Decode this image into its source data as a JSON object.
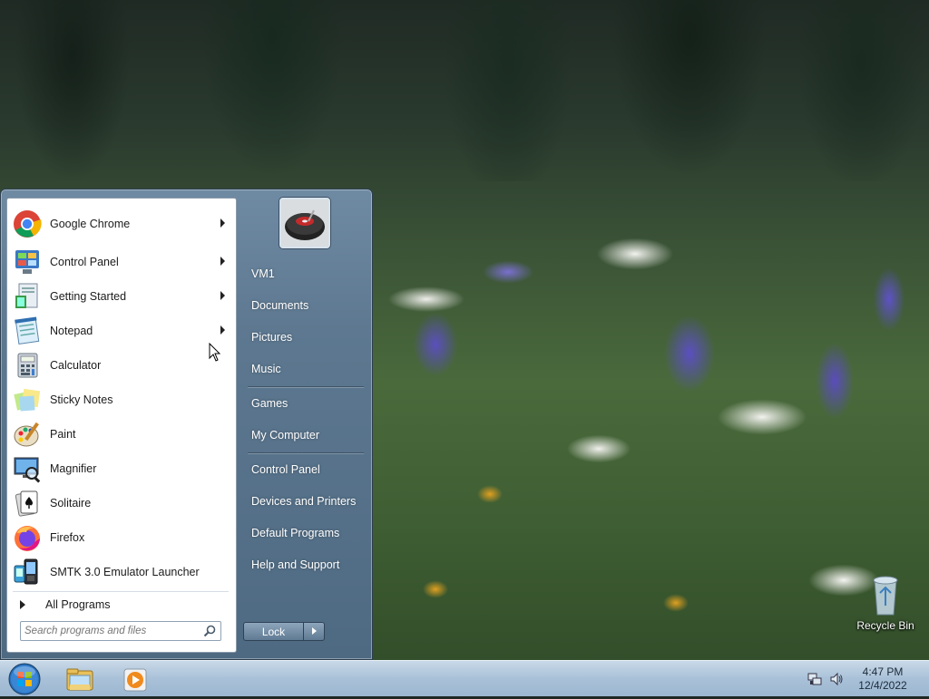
{
  "start_menu": {
    "pinned_programs": [
      {
        "label": "Google Chrome",
        "icon": "chrome-icon",
        "has_submenu": true
      },
      {
        "label": "Control Panel",
        "icon": "control-panel-icon",
        "has_submenu": true
      },
      {
        "label": "Getting Started",
        "icon": "getting-started-icon",
        "has_submenu": true
      },
      {
        "label": "Notepad",
        "icon": "notepad-icon",
        "has_submenu": true
      },
      {
        "label": "Calculator",
        "icon": "calculator-icon",
        "has_submenu": false
      },
      {
        "label": "Sticky Notes",
        "icon": "sticky-notes-icon",
        "has_submenu": false
      },
      {
        "label": "Paint",
        "icon": "paint-icon",
        "has_submenu": false
      },
      {
        "label": "Magnifier",
        "icon": "magnifier-icon",
        "has_submenu": false
      },
      {
        "label": "Solitaire",
        "icon": "solitaire-icon",
        "has_submenu": false
      },
      {
        "label": "Firefox",
        "icon": "firefox-icon",
        "has_submenu": false
      },
      {
        "label": "SMTK 3.0 Emulator Launcher",
        "icon": "smtk-icon",
        "has_submenu": false
      }
    ],
    "all_programs_label": "All Programs",
    "search": {
      "placeholder": "Search programs and files",
      "value": ""
    },
    "user_picture_icon": "user-avatar-icon",
    "right_items": [
      {
        "label": "VM1",
        "name": "user-folder-link"
      },
      {
        "label": "Documents",
        "name": "documents-link"
      },
      {
        "label": "Pictures",
        "name": "pictures-link"
      },
      {
        "label": "Music",
        "name": "music-link"
      },
      {
        "label": "Games",
        "name": "games-link"
      },
      {
        "label": "My Computer",
        "name": "my-computer-link"
      },
      {
        "label": "Control Panel",
        "name": "control-panel-link"
      },
      {
        "label": "Devices and Printers",
        "name": "devices-printers-link"
      },
      {
        "label": "Default Programs",
        "name": "default-programs-link"
      },
      {
        "label": "Help and Support",
        "name": "help-support-link"
      }
    ],
    "lock_label": "Lock"
  },
  "desktop": {
    "recycle_bin_label": "Recycle Bin"
  },
  "taskbar": {
    "pinned": [
      "start-orb-icon",
      "explorer-icon",
      "media-player-icon"
    ],
    "tray_icons": [
      "network-icon",
      "volume-icon"
    ],
    "time": "4:47 PM",
    "date": "12/4/2022"
  }
}
